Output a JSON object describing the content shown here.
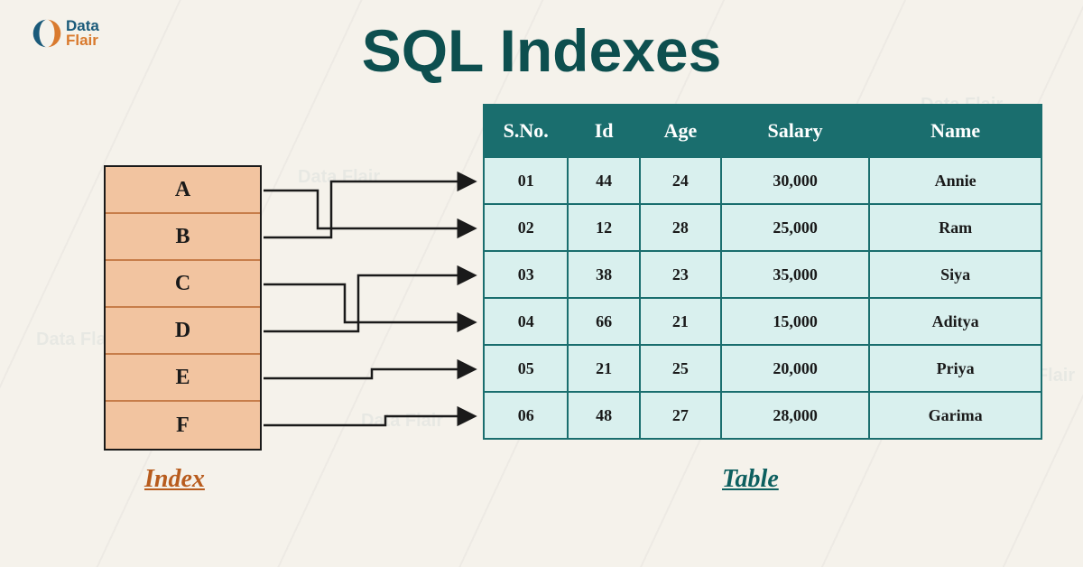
{
  "brand": {
    "line1": "Data",
    "line2": "Flair"
  },
  "title": "SQL Indexes",
  "index": {
    "caption": "Index",
    "items": [
      "A",
      "B",
      "C",
      "D",
      "E",
      "F"
    ]
  },
  "table": {
    "caption": "Table",
    "headers": [
      "S.No.",
      "Id",
      "Age",
      "Salary",
      "Name"
    ],
    "rows": [
      {
        "sno": "01",
        "id": "44",
        "age": "24",
        "salary": "30,000",
        "name": "Annie"
      },
      {
        "sno": "02",
        "id": "12",
        "age": "28",
        "salary": "25,000",
        "name": "Ram"
      },
      {
        "sno": "03",
        "id": "38",
        "age": "23",
        "salary": "35,000",
        "name": "Siya"
      },
      {
        "sno": "04",
        "id": "66",
        "age": "21",
        "salary": "15,000",
        "name": "Aditya"
      },
      {
        "sno": "05",
        "id": "21",
        "age": "25",
        "salary": "20,000",
        "name": "Priya"
      },
      {
        "sno": "06",
        "id": "48",
        "age": "27",
        "salary": "28,000",
        "name": "Garima"
      }
    ]
  },
  "mapping": [
    {
      "from": 0,
      "to": 1
    },
    {
      "from": 1,
      "to": 0
    },
    {
      "from": 2,
      "to": 3
    },
    {
      "from": 3,
      "to": 2
    },
    {
      "from": 4,
      "to": 4
    },
    {
      "from": 5,
      "to": 5
    }
  ],
  "colors": {
    "teal_header": "#1a6e6e",
    "teal_dark": "#0d4f4f",
    "cell_bg": "#d9f0ee",
    "index_bg": "#f2c4a0",
    "index_border": "#c77d4a",
    "orange": "#b85c1e"
  }
}
